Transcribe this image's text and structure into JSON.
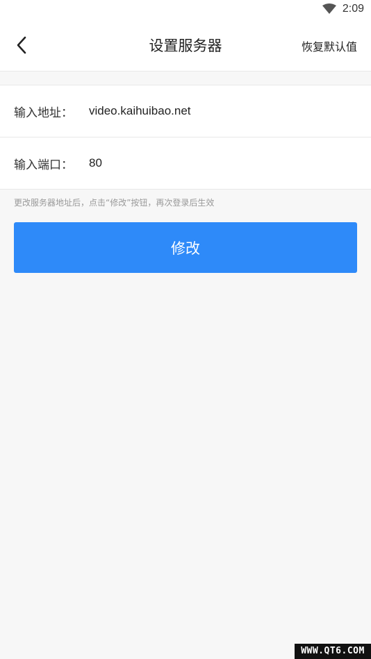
{
  "status_bar": {
    "time": "2:09",
    "wifi_icon": "wifi-icon"
  },
  "nav": {
    "back_icon": "chevron-left-icon",
    "title": "设置服务器",
    "reset_label": "恢复默认值"
  },
  "form": {
    "address_label": "输入地址：",
    "address_value": "video.kaihuibao.net",
    "port_label": "输入端口：",
    "port_value": "80"
  },
  "hint": "更改服务器地址后，点击“修改”按钮，再次登录后生效",
  "submit_label": "修改",
  "watermark": "WWW.QT6.COM",
  "colors": {
    "accent": "#2e8af9",
    "background": "#f7f7f7"
  }
}
